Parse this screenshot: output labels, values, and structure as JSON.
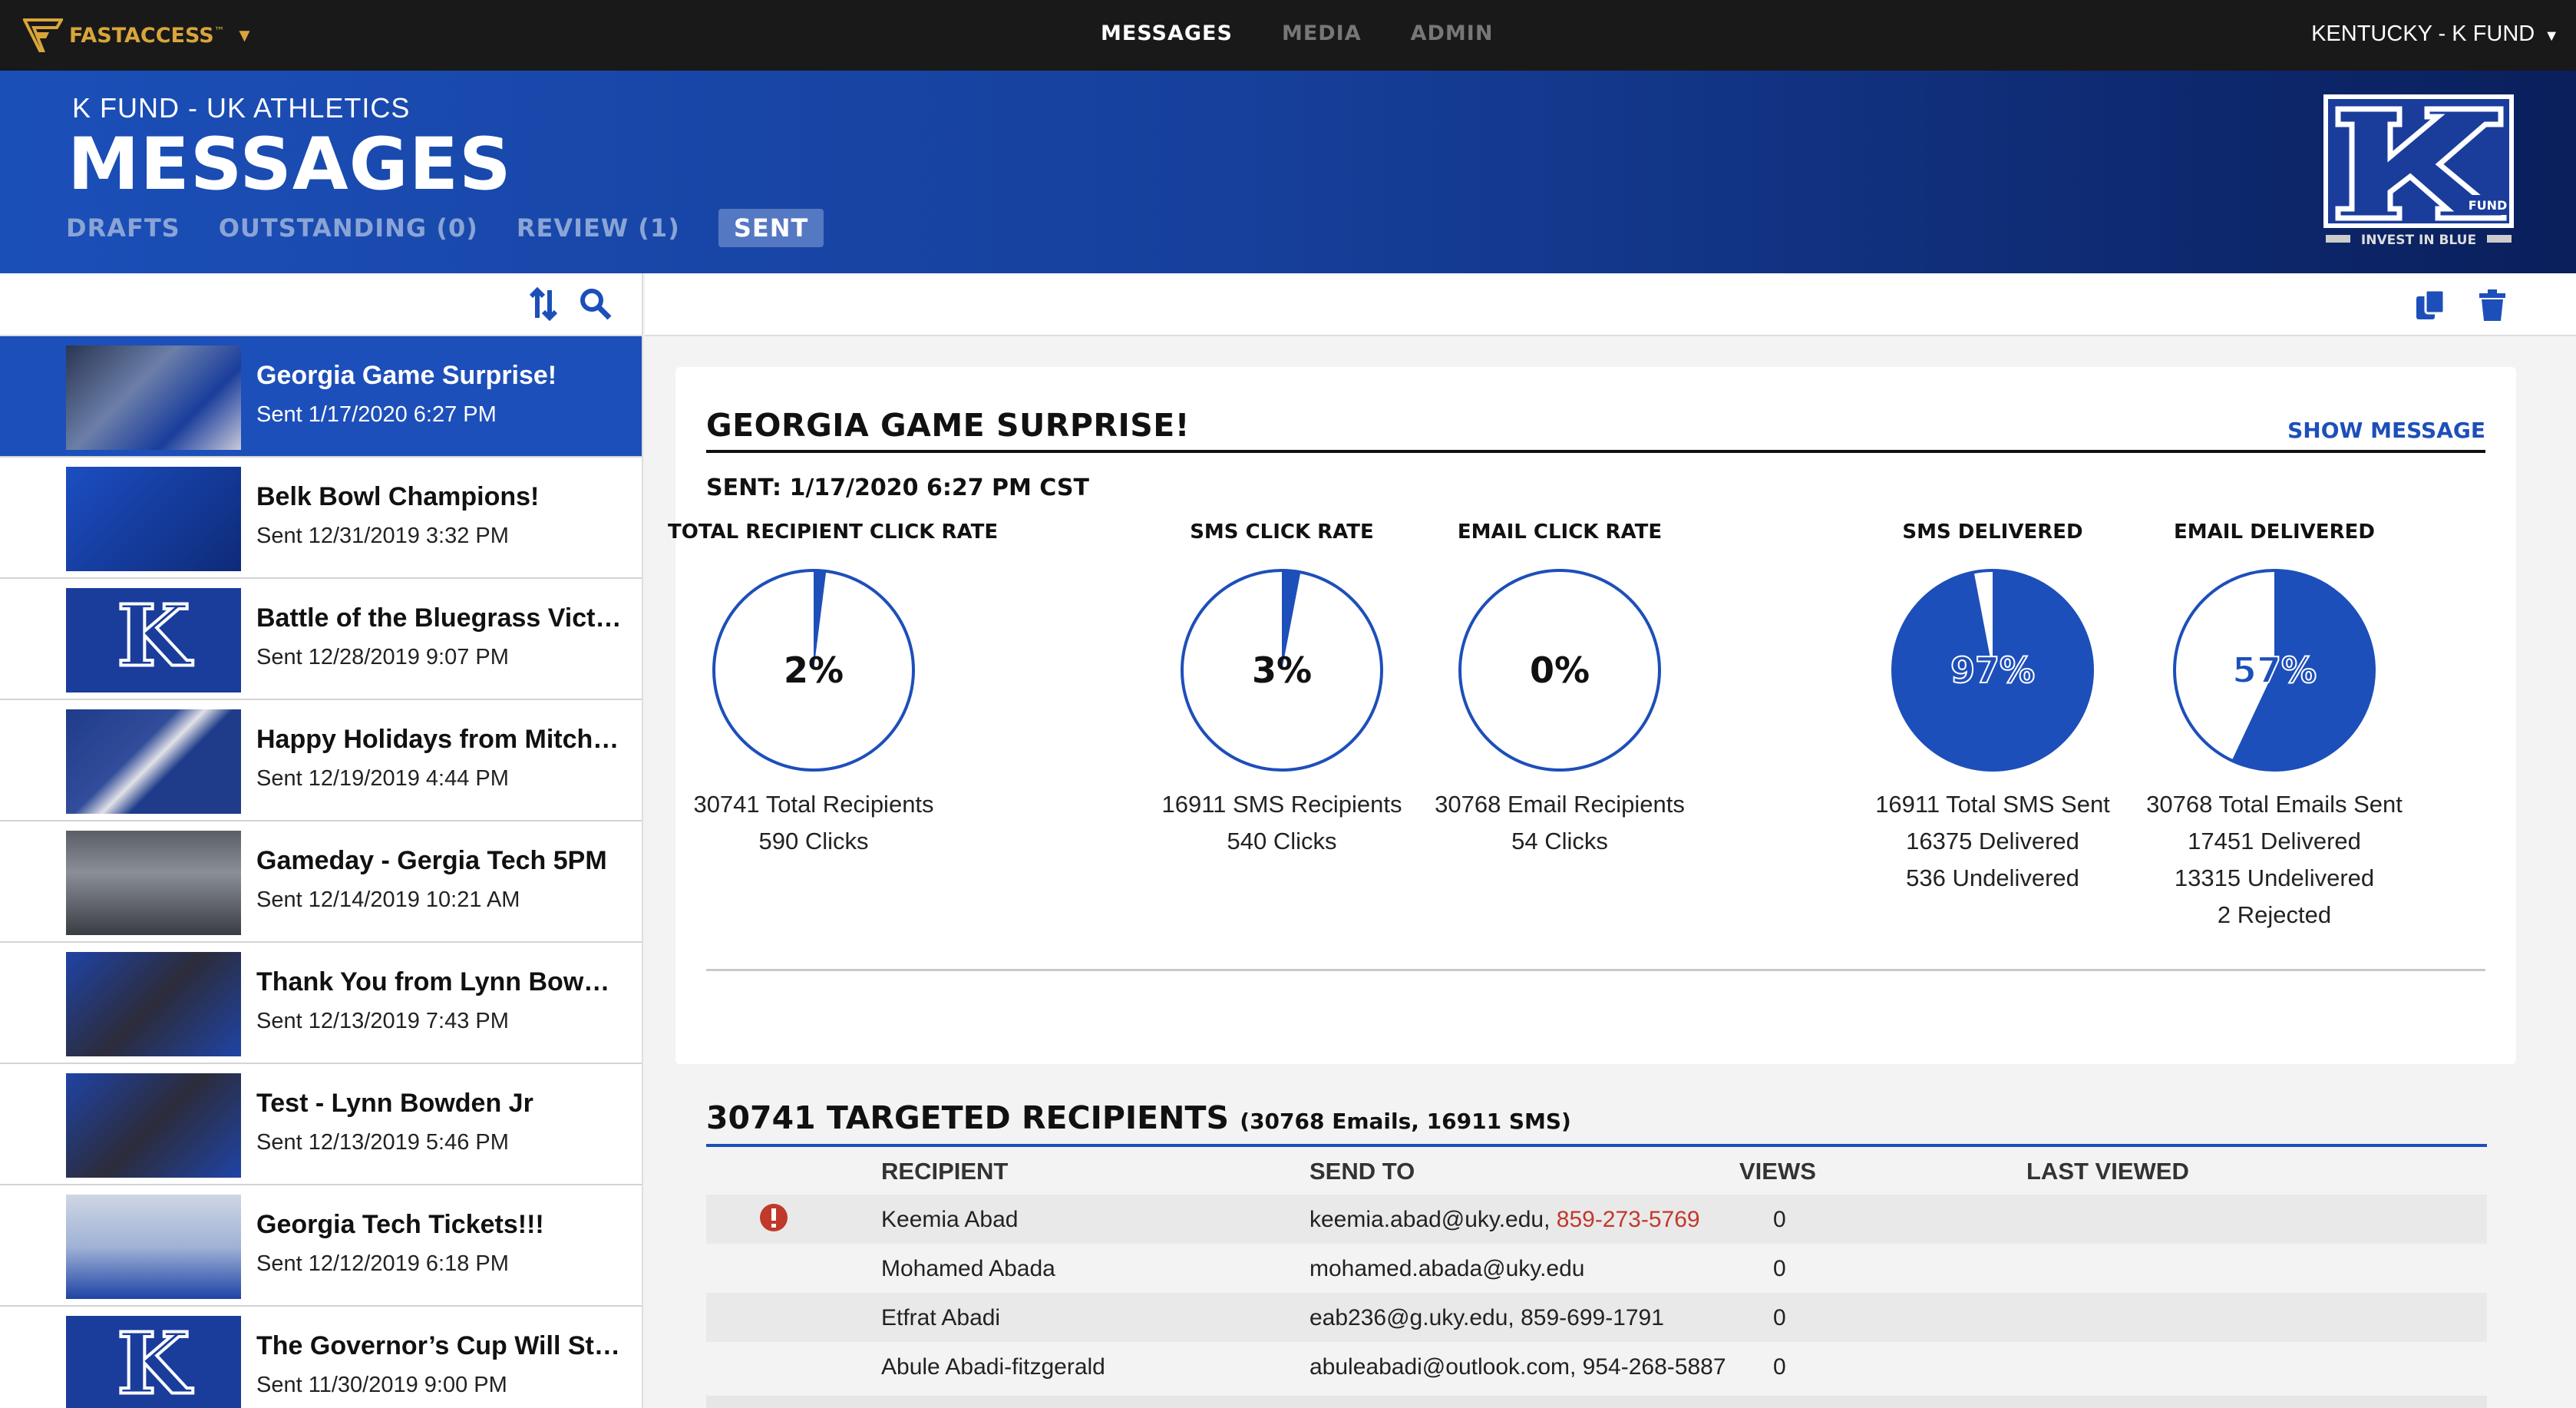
{
  "topbar": {
    "brand": "FASTACCESS",
    "brand_tm": "™",
    "nav": [
      "MESSAGES",
      "MEDIA",
      "ADMIN"
    ],
    "account": "KENTUCKY - K FUND"
  },
  "header": {
    "org": "K FUND - UK ATHLETICS",
    "title": "MESSAGES",
    "tabs": [
      "DRAFTS",
      "OUTSTANDING (0)",
      "REVIEW (1)",
      "SENT"
    ],
    "logo_text": "INVEST IN BLUE",
    "logo_sub": "FUND"
  },
  "messages": [
    {
      "title": "Georgia Game Surprise!",
      "date": "Sent 1/17/2020 6:27 PM"
    },
    {
      "title": "Belk Bowl Champions!",
      "date": "Sent 12/31/2019 3:32 PM"
    },
    {
      "title": "Battle of the Bluegrass Vict…",
      "date": "Sent 12/28/2019 9:07 PM"
    },
    {
      "title": "Happy Holidays from Mitch…",
      "date": "Sent 12/19/2019 4:44 PM"
    },
    {
      "title": "Gameday - Gergia Tech 5PM",
      "date": "Sent 12/14/2019 10:21 AM"
    },
    {
      "title": "Thank You from Lynn Bowd…",
      "date": "Sent 12/13/2019 7:43 PM"
    },
    {
      "title": "Test - Lynn Bowden Jr",
      "date": "Sent 12/13/2019 5:46 PM"
    },
    {
      "title": "Georgia Tech Tickets!!!",
      "date": "Sent 12/12/2019 6:18 PM"
    },
    {
      "title": "The Governor’s Cup Will St…",
      "date": "Sent 11/30/2019 9:00 PM"
    }
  ],
  "detail": {
    "title": "GEORGIA GAME SURPRISE!",
    "show_message": "SHOW MESSAGE",
    "sent": "SENT: 1/17/2020 6:27 PM CST",
    "stats": [
      {
        "label": "TOTAL RECIPIENT CLICK RATE",
        "percent": 2,
        "text": "2%",
        "lines": [
          "30741 Total Recipients",
          "590 Clicks"
        ]
      },
      {
        "label": "SMS CLICK RATE",
        "percent": 3,
        "text": "3%",
        "lines": [
          "16911 SMS Recipients",
          "540 Clicks"
        ]
      },
      {
        "label": "EMAIL CLICK RATE",
        "percent": 0,
        "text": "0%",
        "lines": [
          "30768 Email Recipients",
          "54 Clicks"
        ]
      },
      {
        "label": "SMS DELIVERED",
        "percent": 97,
        "text": "97%",
        "lines": [
          "16911 Total SMS Sent",
          "16375 Delivered",
          "536 Undelivered"
        ]
      },
      {
        "label": "EMAIL DELIVERED",
        "percent": 57,
        "text": "57%",
        "lines": [
          "30768 Total Emails Sent",
          "17451 Delivered",
          "13315 Undelivered",
          "2 Rejected"
        ]
      }
    ]
  },
  "recipients": {
    "title": "30741 TARGETED RECIPIENTS",
    "subtitle": "(30768 Emails, 16911 SMS)",
    "columns": [
      "RECIPIENT",
      "SEND TO",
      "VIEWS",
      "LAST VIEWED"
    ],
    "rows": [
      {
        "name": "Keemia Abad",
        "email": "keemia.abad@uky.edu,",
        "phone": "859-273-5769",
        "views": "0",
        "alert": true
      },
      {
        "name": "Mohamed Abada",
        "email": "mohamed.abada@uky.edu",
        "phone": "",
        "views": "0",
        "alert": false
      },
      {
        "name": "Etfrat Abadi",
        "email": "eab236@g.uky.edu, 859-699-1791",
        "phone": "",
        "views": "0",
        "alert": false
      },
      {
        "name": "Abule Abadi-fitzgerald",
        "email": "abuleabadi@outlook.com, 954-268-5887",
        "phone": "",
        "views": "0",
        "alert": false
      }
    ]
  },
  "colors": {
    "brand_blue": "#1d4fba",
    "gold": "#d9a53a",
    "alert_red": "#c0392b"
  }
}
